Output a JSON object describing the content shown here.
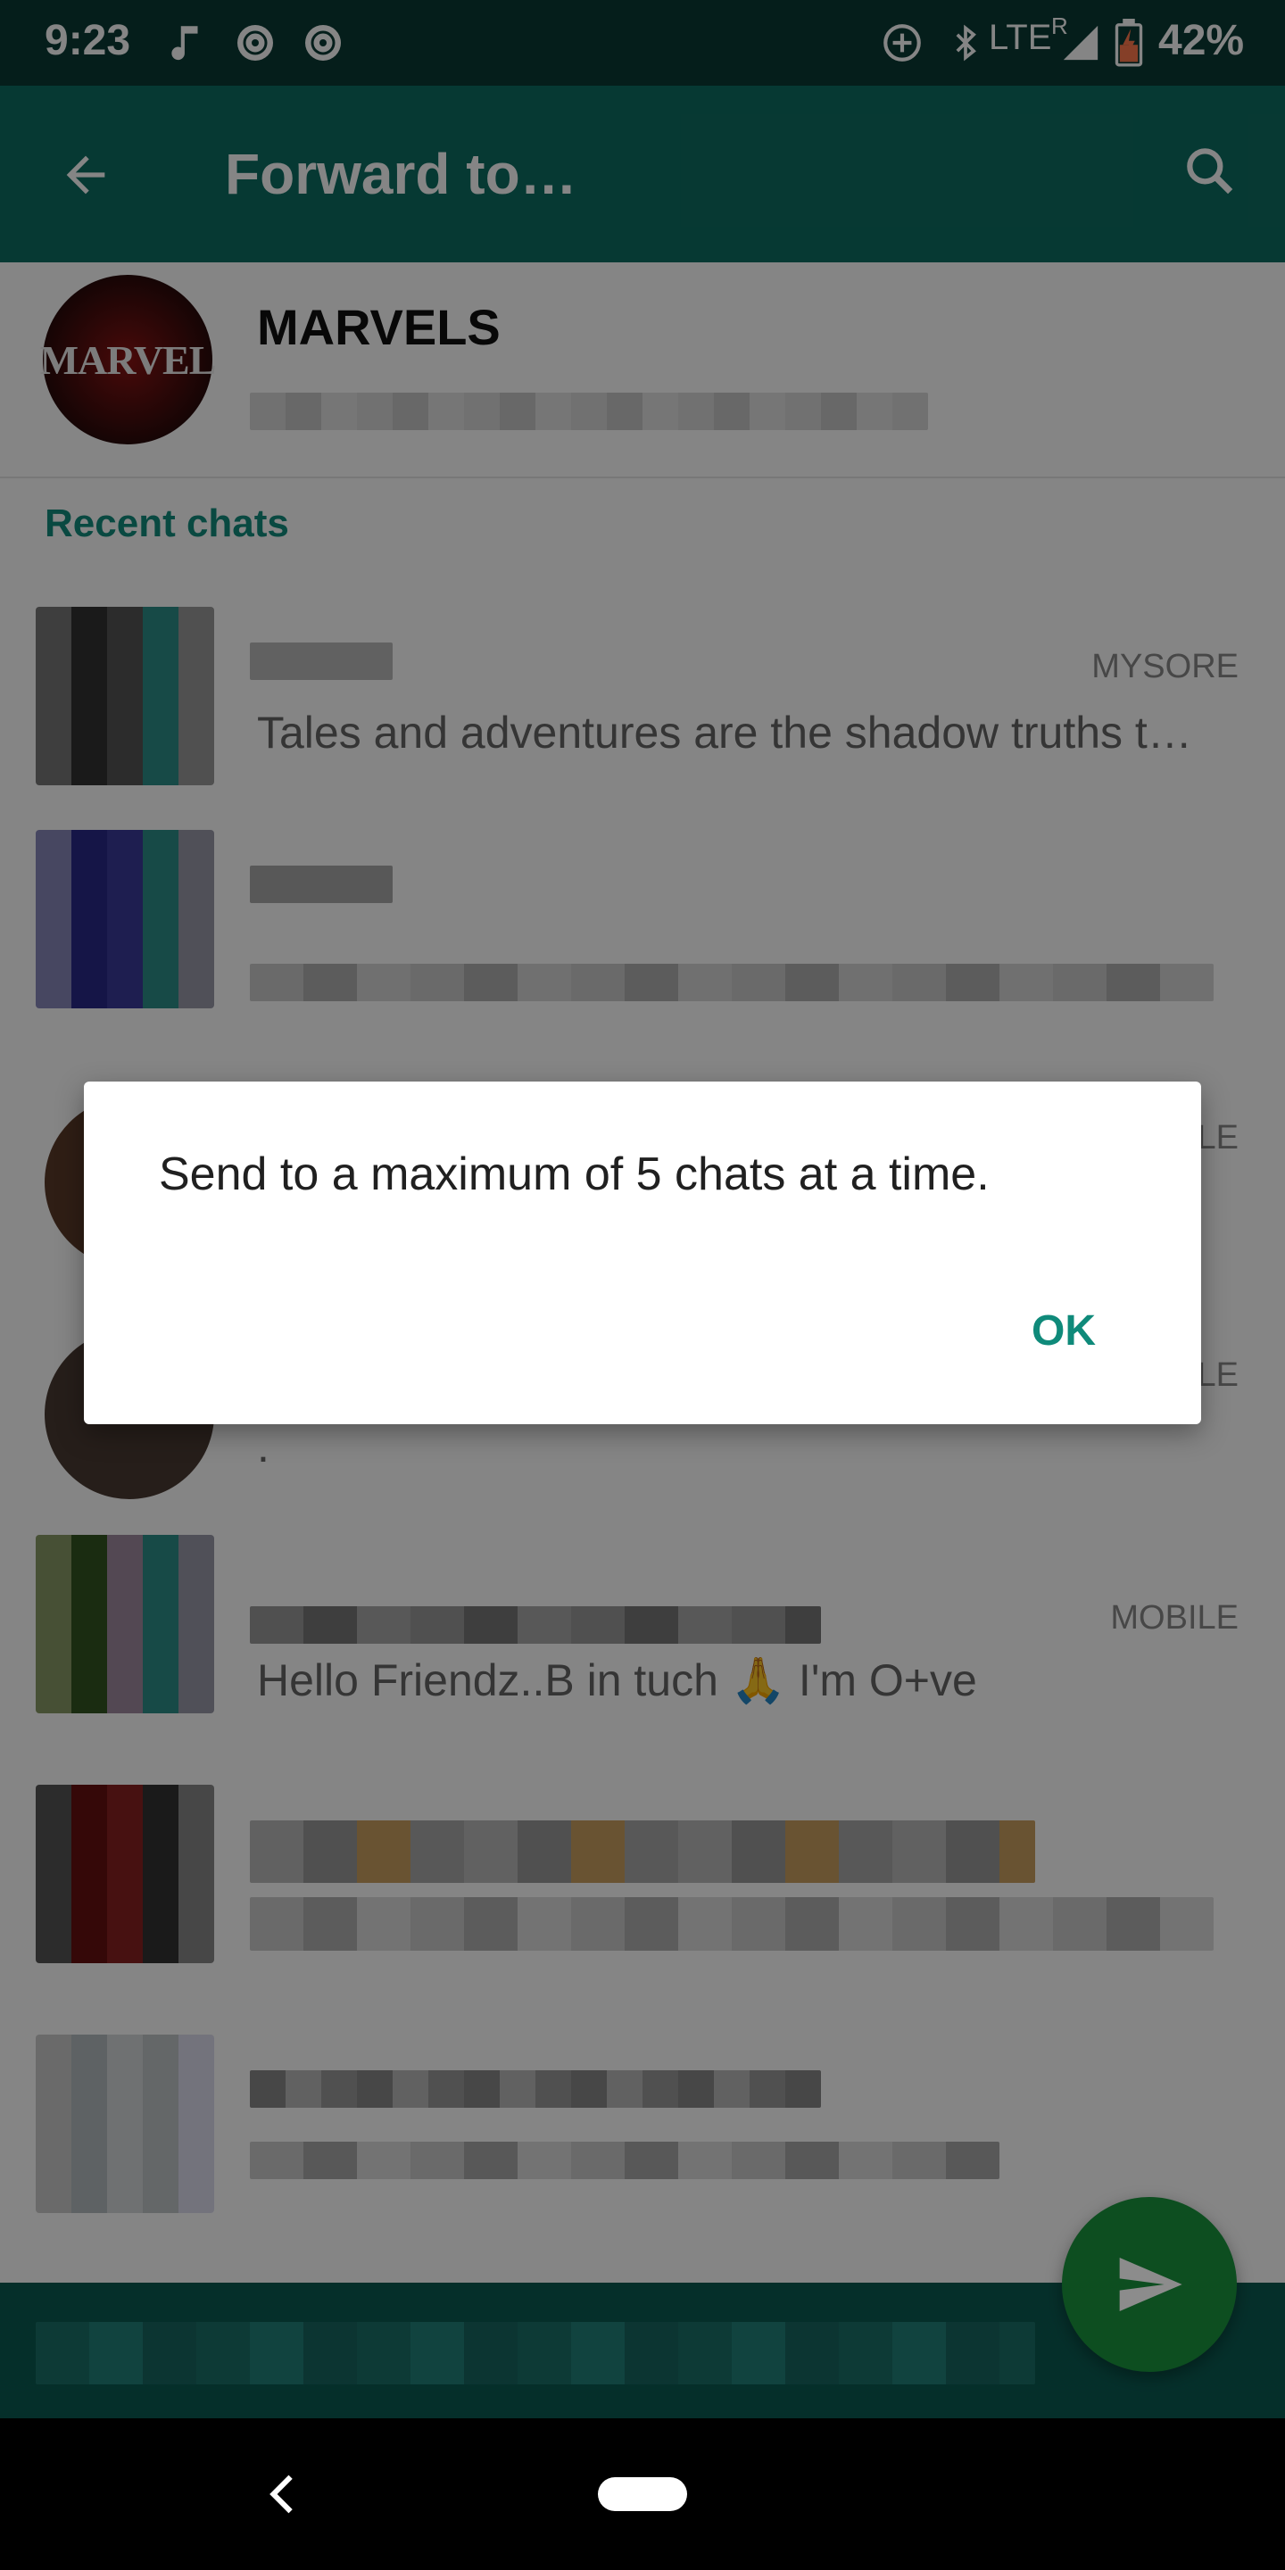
{
  "status_bar": {
    "time": "9:23",
    "network": "LTE",
    "roaming": "R",
    "battery": "42%",
    "icons": [
      "music-note-icon",
      "disc-icon",
      "disc-icon",
      "add-circle-icon",
      "bluetooth-icon",
      "signal-icon",
      "battery-icon"
    ]
  },
  "app_bar": {
    "title": "Forward to…",
    "back_icon": "arrow-back-icon",
    "search_icon": "search-icon"
  },
  "pinned": {
    "name": "MARVELS",
    "avatar_text": "MARVEL"
  },
  "recent_section": {
    "title": "Recent chats"
  },
  "chats": [
    {
      "meta": "MYSORE",
      "preview": "Tales and adventures are the shadow truths t…"
    },
    {
      "meta": "",
      "preview": ""
    },
    {
      "meta": "LE",
      "preview": ""
    },
    {
      "meta": "LE",
      "preview": "."
    },
    {
      "meta": "MOBILE",
      "preview": "Hello Friendz..B in tuch 🙏 I'm O+ve"
    }
  ],
  "dialog": {
    "message": "Send to a maximum of 5 chats at a time.",
    "ok_label": "OK"
  },
  "fab": {
    "icon": "send-icon"
  },
  "nav_bar": {
    "icons": [
      "back-chevron-icon",
      "home-pill-icon"
    ]
  },
  "colors": {
    "primary": "#0d6e62",
    "accent": "#128c7e",
    "fab": "#188d3b"
  }
}
